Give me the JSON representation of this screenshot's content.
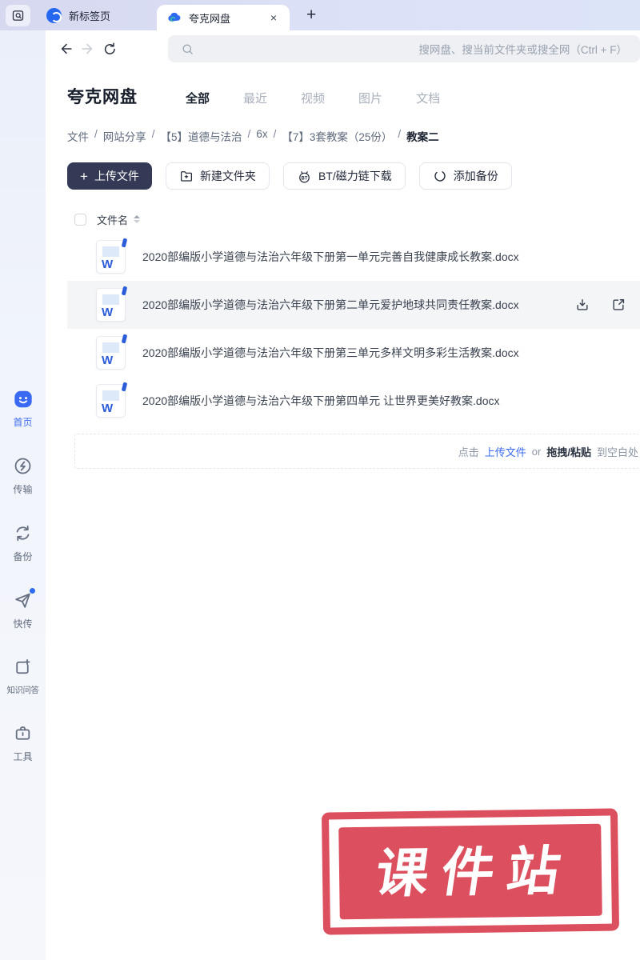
{
  "colors": {
    "accent_blue": "#3b6af2",
    "tabbar_bg": "#dadcf2",
    "dark_button_bg": "#343a55",
    "stamp_red": "#dc4f5e",
    "word_icon_blue": "#2b5cd9",
    "hover_row_bg": "#f4f5f7"
  },
  "browser": {
    "tabs": [
      {
        "label": "新标签页",
        "active": false
      },
      {
        "label": "夸克网盘",
        "active": true
      }
    ],
    "close_button": "×",
    "new_tab_button": "+"
  },
  "toolbar": {
    "search_placeholder": "搜网盘、搜当前文件夹或搜全网（Ctrl + F）"
  },
  "header": {
    "title": "夸克网盘",
    "filter_tabs": [
      {
        "label": "全部",
        "active": true
      },
      {
        "label": "最近",
        "active": false
      },
      {
        "label": "视频",
        "active": false
      },
      {
        "label": "图片",
        "active": false
      },
      {
        "label": "文档",
        "active": false
      }
    ]
  },
  "breadcrumb": {
    "separator": "/",
    "items": [
      "文件",
      "网站分享",
      "【5】道德与法治",
      "6x",
      "【7】3套教案（25份）",
      "教案二"
    ]
  },
  "actions": {
    "upload": "上传文件",
    "new_folder": "新建文件夹",
    "bt_download": "BT/磁力链下载",
    "bt_badge": "BT",
    "add_backup": "添加备份"
  },
  "file_table": {
    "name_header": "文件名",
    "word_badge": "W",
    "files": [
      {
        "name": "2020部编版小学道德与法治六年级下册第一单元完善自我健康成长教案.docx",
        "type": "docx",
        "hovered": false
      },
      {
        "name": "2020部编版小学道德与法治六年级下册第二单元爱护地球共同责任教案.docx",
        "type": "docx",
        "hovered": true
      },
      {
        "name": "2020部编版小学道德与法治六年级下册第三单元多样文明多彩生活教案.docx",
        "type": "docx",
        "hovered": false
      },
      {
        "name": "2020部编版小学道德与法治六年级下册第四单元 让世界更美好教案.docx",
        "type": "docx",
        "hovered": false
      }
    ]
  },
  "upload_hint": {
    "prefix": "点击",
    "upload_link": "上传文件",
    "conjunction": "or",
    "drag_label": "拖拽/粘贴",
    "suffix": "到空白处"
  },
  "sidebar": {
    "items": [
      {
        "label": "首页",
        "active": true,
        "badge": false
      },
      {
        "label": "传输",
        "active": false,
        "badge": false
      },
      {
        "label": "备份",
        "active": false,
        "badge": false
      },
      {
        "label": "快传",
        "active": false,
        "badge": true
      },
      {
        "label": "知识问答",
        "active": false,
        "badge": false
      },
      {
        "label": "工具",
        "active": false,
        "badge": false
      }
    ]
  },
  "watermark": {
    "text": "课件站"
  }
}
